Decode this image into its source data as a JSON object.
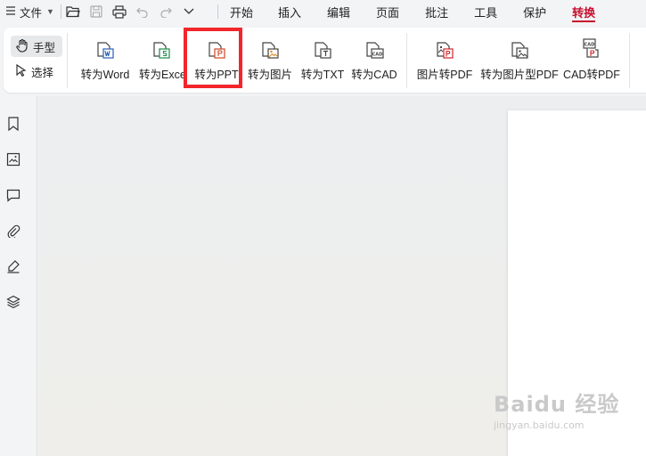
{
  "menubar": {
    "file_label": "文件",
    "tabs": [
      "开始",
      "插入",
      "编辑",
      "页面",
      "批注",
      "工具",
      "保护",
      "转换"
    ],
    "active_tab": "转换"
  },
  "ribbon": {
    "hand_tool_label": "手型",
    "select_tool_label": "选择",
    "convert_buttons": [
      {
        "label": "转为Word",
        "icon": "word-file-icon"
      },
      {
        "label": "转为Excel",
        "icon": "excel-file-icon"
      },
      {
        "label": "转为PPT",
        "icon": "ppt-file-icon"
      },
      {
        "label": "转为图片",
        "icon": "image-file-icon"
      },
      {
        "label": "转为TXT",
        "icon": "txt-file-icon"
      },
      {
        "label": "转为CAD",
        "icon": "cad-file-icon"
      }
    ],
    "to_pdf_buttons": [
      {
        "label": "图片转PDF",
        "icon": "image-to-pdf-icon"
      },
      {
        "label": "转为图片型PDF",
        "icon": "image-pdf-icon"
      },
      {
        "label": "CAD转PDF",
        "icon": "cad-to-pdf-icon"
      }
    ],
    "highlighted_button": "转为PPT"
  },
  "watermark": {
    "main": "Baidu 经验",
    "sub": "jingyan.baidu.com"
  },
  "colors": {
    "accent": "#c8102e",
    "highlight_border": "#f2262b",
    "ribbon_bg": "#ffffff",
    "app_bg": "#f3f4f6"
  }
}
